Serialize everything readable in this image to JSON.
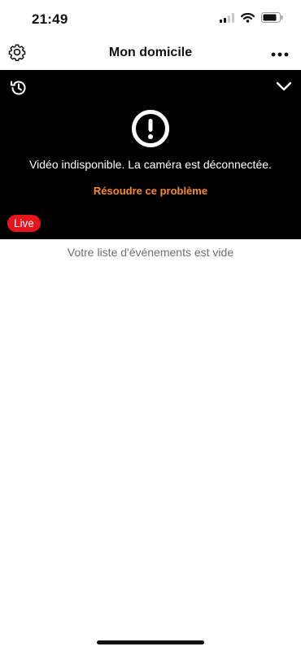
{
  "status_bar": {
    "time": "21:49",
    "icons": [
      "cellular-signal-icon",
      "wifi-icon",
      "battery-icon"
    ]
  },
  "header": {
    "title": "Mon domicile",
    "left_icon": "gear-icon",
    "right_icon": "more-horizontal-icon"
  },
  "video": {
    "top_left_icon": "history-icon",
    "top_right_icon": "chevron-down-icon",
    "status_icon": "exclamation-circle-icon",
    "message": "Vidéo indisponible. La caméra est déconnectée.",
    "action_label": "Résoudre ce problème",
    "live_label": "Live"
  },
  "events": {
    "empty_message": "Votre liste d'événements est vide"
  },
  "colors": {
    "accent_orange": "#f58a2c",
    "live_red": "#e8141c",
    "video_background": "#000000",
    "muted_text": "#6e6e73"
  }
}
